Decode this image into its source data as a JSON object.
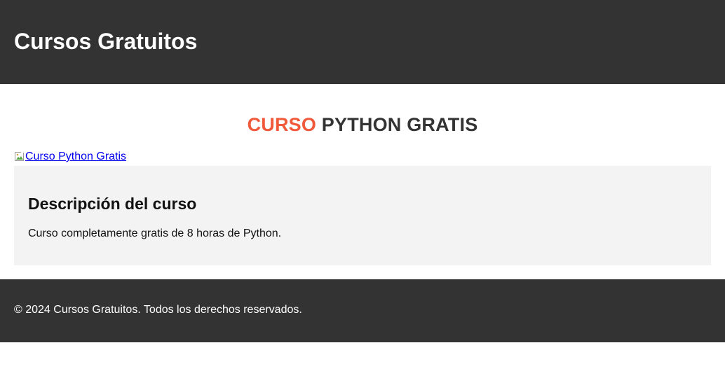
{
  "header": {
    "title": "Cursos Gratuitos",
    "background_color": "#333333"
  },
  "course": {
    "heading_accent": "CURSO",
    "heading_rest": " PYTHON GRATIS",
    "accent_color": "#f05a3a",
    "image_alt": "Curso Python Gratis",
    "image_icon": "broken-image-icon"
  },
  "description": {
    "title": "Descripción del curso",
    "text": "Curso completamente gratis de 8 horas de Python."
  },
  "footer": {
    "text": "© 2024 Cursos Gratuitos. Todos los derechos reservados."
  }
}
